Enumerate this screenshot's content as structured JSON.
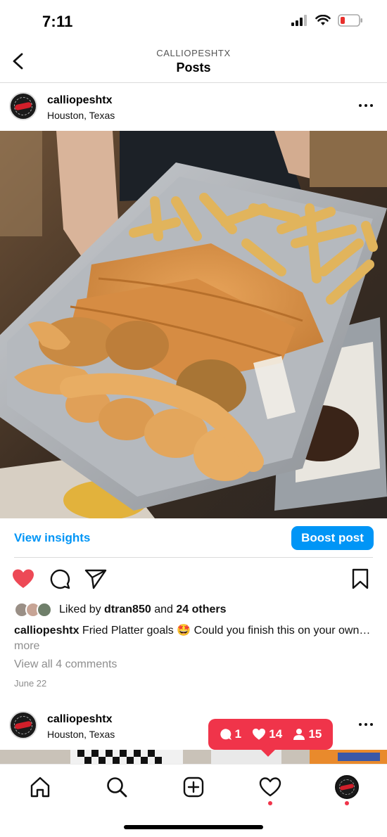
{
  "status_bar": {
    "time": "7:11"
  },
  "header": {
    "subtitle": "CALLIOPESHTX",
    "title": "Posts"
  },
  "post": {
    "username": "calliopeshtx",
    "location": "Houston, Texas",
    "insights_label": "View insights",
    "boost_label": "Boost post",
    "likes": {
      "prefix": "Liked by ",
      "user": "dtran850",
      "middle": " and ",
      "others": "24 others"
    },
    "caption": {
      "user": "calliopeshtx",
      "text": " Fried Platter goals 🤩 Could you finish this on your own…",
      "more": " more"
    },
    "comments_link": "View all 4 comments",
    "date": "June 22"
  },
  "next_post": {
    "username": "calliopeshtx",
    "location": "Houston, Texas"
  },
  "activity_pill": {
    "comments": "1",
    "likes": "14",
    "follows": "15"
  },
  "colors": {
    "accent": "#0095f6",
    "like_red": "#ed4956",
    "pill_red": "#f0344a"
  },
  "tab_bar": {
    "icons": [
      "home-icon",
      "search-icon",
      "create-icon",
      "activity-heart-icon",
      "profile-avatar"
    ]
  }
}
